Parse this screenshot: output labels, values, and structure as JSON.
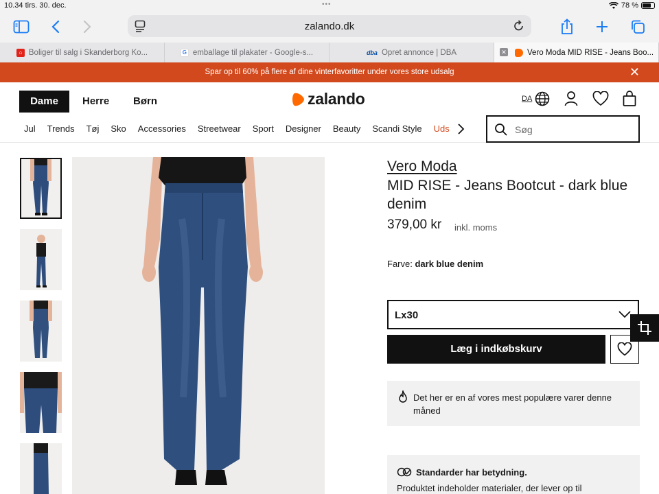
{
  "status_bar": {
    "time": "10.34",
    "date": "tirs. 30. dec.",
    "battery": "78 %",
    "battery_level": 0.78
  },
  "browser": {
    "url": "zalando.dk",
    "tabs": [
      {
        "title": "Boliger til salg i Skanderborg Ko...",
        "favicon_color": "#e2231a"
      },
      {
        "title": "emballage til plakater - Google-s...",
        "favicon_color": "#4285f4"
      },
      {
        "title": "Opret annonce | DBA",
        "favicon_color": "#0a4fa3",
        "favicon_text": "dba"
      },
      {
        "title": "Vero Moda MID RISE - Jeans Boo...",
        "favicon_color": "#ff6900",
        "active": true
      }
    ]
  },
  "promo": {
    "text": "Spar op til 60% på flere af dine vinterfavoritter under vores store udsalg"
  },
  "header": {
    "genders": [
      "Dame",
      "Herre",
      "Børn"
    ],
    "logo": "zalando",
    "language": "DA",
    "categories": [
      "Jul",
      "Trends",
      "Tøj",
      "Sko",
      "Accessories",
      "Streetwear",
      "Sport",
      "Designer",
      "Beauty",
      "Scandi Style",
      "Uds"
    ],
    "search_placeholder": "Søg"
  },
  "product": {
    "brand": "Vero Moda",
    "name": "MID RISE - Jeans Bootcut - dark blue denim",
    "price": "379,00 kr",
    "vat_note": "inkl. moms",
    "color_label": "Farve:",
    "color_value": "dark blue denim",
    "size": "Lx30",
    "add_to_cart": "Læg i indkøbskurv",
    "popular_note": "Det her er en af vores mest populære varer denne måned",
    "standards_title": "Standarder har betydning.",
    "standards_body": "Produktet indeholder materialer, der lever op til"
  },
  "colors": {
    "accent": "#d2491d",
    "brand_orange": "#ff6900",
    "denim": "#2e4d7c",
    "ios_blue": "#1a7cf5"
  }
}
